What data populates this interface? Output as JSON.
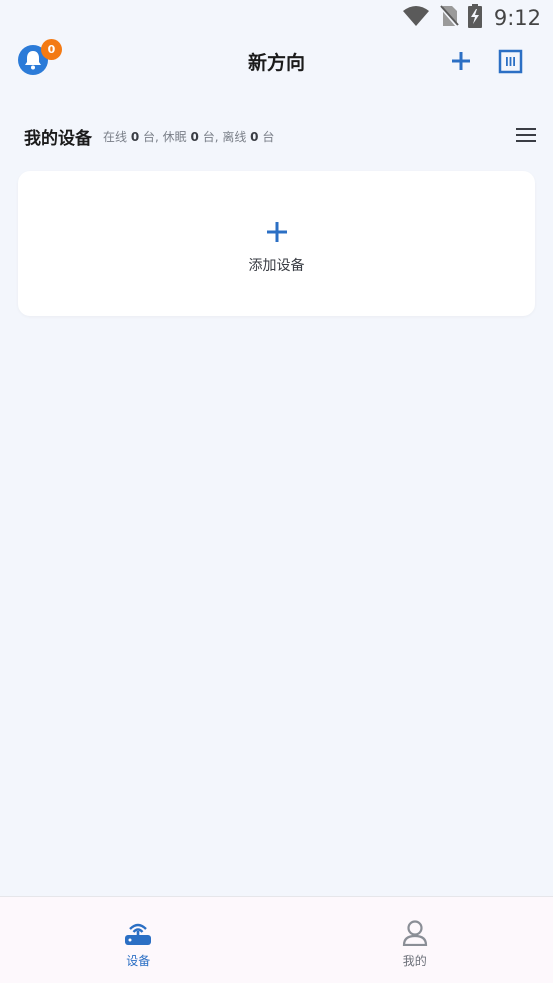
{
  "status_bar": {
    "time": "9:12",
    "icons": [
      "wifi-icon",
      "no-sim-icon",
      "battery-charging-icon"
    ]
  },
  "header": {
    "title": "新方向",
    "notification_count": "0",
    "icons": [
      "bell-icon",
      "plus-icon",
      "scan-icon"
    ]
  },
  "devices_section": {
    "title": "我的设备",
    "stats": {
      "online_label": "在线",
      "online_count": "0",
      "sleep_label": "台, 休眠",
      "sleep_count": "0",
      "offline_label": "台, 离线",
      "offline_count": "0",
      "unit": "台"
    },
    "menu_icon": "menu-icon"
  },
  "add_device_card": {
    "label": "添加设备",
    "icon": "plus-icon"
  },
  "bottom_nav": {
    "tabs": [
      {
        "label": "设备",
        "icon": "router-icon",
        "active": true
      },
      {
        "label": "我的",
        "icon": "person-icon",
        "active": false
      }
    ]
  },
  "colors": {
    "accent": "#2b6fc4",
    "badge": "#f37a14",
    "background": "#f3f6fc"
  }
}
